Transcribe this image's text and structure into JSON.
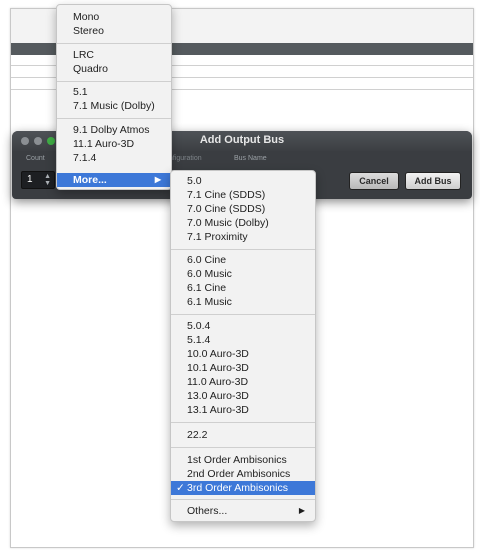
{
  "dialog": {
    "title": "Add Output Bus",
    "count_header": "Count",
    "configuration_header": "Configuration",
    "bus_name_header": "Bus Name",
    "count_value": "1",
    "cancel_label": "Cancel",
    "add_bus_label": "Add Bus"
  },
  "menu1": {
    "items": [
      "Mono",
      "Stereo",
      "LRC",
      "Quadro",
      "5.1",
      "7.1 Music (Dolby)",
      "9.1 Dolby Atmos",
      "11.1 Auro-3D",
      "7.1.4"
    ],
    "more_label": "More...",
    "more_arrow": "▶"
  },
  "menu2": {
    "items": [
      "5.0",
      "7.1 Cine (SDDS)",
      "7.0 Cine (SDDS)",
      "7.0 Music (Dolby)",
      "7.1 Proximity",
      "6.0 Cine",
      "6.0 Music",
      "6.1 Cine",
      "6.1 Music",
      "5.0.4",
      "5.1.4",
      "10.0 Auro-3D",
      "10.1 Auro-3D",
      "11.0 Auro-3D",
      "13.0 Auro-3D",
      "13.1 Auro-3D",
      "22.2",
      "1st Order Ambisonics",
      "2nd Order Ambisonics",
      "3rd Order Ambisonics",
      "Others..."
    ],
    "selected_mark": "✓",
    "others_arrow": "▶"
  },
  "colors": {
    "highlight": "#3d78d8",
    "dialog_bg": "#3a3d41",
    "zoom_button": "#3fae45"
  }
}
